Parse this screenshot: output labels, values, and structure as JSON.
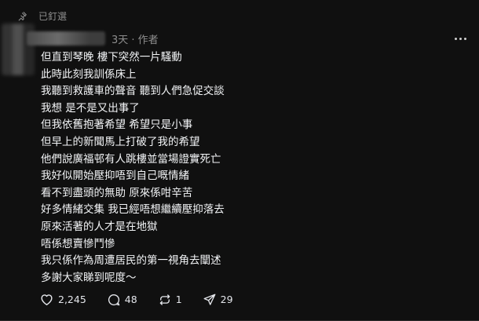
{
  "pinned": {
    "label": "已釘選",
    "icon": "pin-icon"
  },
  "post": {
    "meta": "3天 · 作者",
    "lines": [
      "但直到琴晚 樓下突然一片騷動",
      "此時此刻我訓係床上",
      "我聽到救護車的聲音 聽到人們急促交談",
      "我想 是不是又出事了",
      "但我依舊抱著希望 希望只是小事",
      "但早上的新聞馬上打破了我的希望",
      "他們說廣福邨有人跳樓並當場證實死亡",
      "我好似開始壓抑唔到自己嘅情緒",
      "看不到盡頭的無助 原來係咁辛苦",
      "好多情緒交集 我已經唔想繼續壓抑落去",
      "原來活著的人才是在地獄",
      "唔係想賣慘鬥慘",
      "我只係作為周遭居民的第一視角去闡述",
      "多謝大家睇到呢度～"
    ]
  },
  "actions": {
    "likes": "2,245",
    "comments": "48",
    "reposts": "1",
    "shares": "29"
  },
  "colors": {
    "background": "#101010",
    "text": "#f3f5f7",
    "muted": "#8e8e8e"
  }
}
